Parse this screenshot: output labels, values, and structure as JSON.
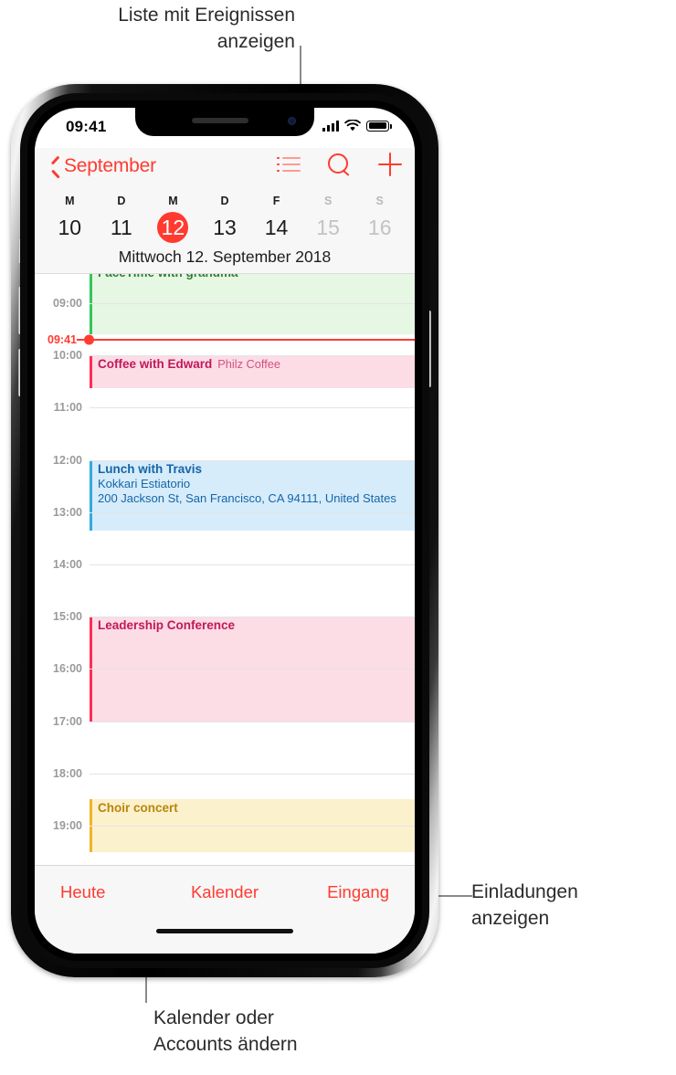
{
  "callouts": [
    {
      "id": "list-view",
      "text": "Liste mit Ereignissen\nanzeigen"
    },
    {
      "id": "inbox",
      "text": "Einladungen\nanzeigen"
    },
    {
      "id": "calendars",
      "text": "Kalender oder\nAccounts ändern"
    }
  ],
  "status_bar": {
    "time": "09:41",
    "signal_icon": "cellular-signal-icon",
    "wifi_icon": "wifi-icon",
    "battery_icon": "battery-icon"
  },
  "nav_bar": {
    "back_label": "September",
    "back_icon": "chevron-left-icon",
    "actions": [
      {
        "name": "list-view-icon",
        "label": "Liste"
      },
      {
        "name": "search-icon",
        "label": "Suchen"
      },
      {
        "name": "add-event-icon",
        "label": "Hinzufügen"
      }
    ]
  },
  "week_strip": {
    "weekday_labels": [
      "M",
      "D",
      "M",
      "D",
      "F",
      "S",
      "S"
    ],
    "days": [
      {
        "num": "10",
        "selected": false,
        "weekend": false
      },
      {
        "num": "11",
        "selected": false,
        "weekend": false
      },
      {
        "num": "12",
        "selected": true,
        "weekend": false
      },
      {
        "num": "13",
        "selected": false,
        "weekend": false
      },
      {
        "num": "14",
        "selected": false,
        "weekend": false
      },
      {
        "num": "15",
        "selected": false,
        "weekend": true
      },
      {
        "num": "16",
        "selected": false,
        "weekend": true
      }
    ],
    "day_title": "Mittwoch  12. September 2018"
  },
  "day_grid": {
    "hours": [
      "09:00",
      "10:00",
      "11:00",
      "12:00",
      "13:00",
      "14:00",
      "15:00",
      "16:00",
      "17:00",
      "18:00",
      "19:00"
    ],
    "now": {
      "label": "09:41",
      "color": "#ff3b30"
    },
    "events": [
      {
        "title": "FaceTime with grandma",
        "location": "",
        "address": "",
        "color": "#34c759",
        "fill": "#e6f7e3",
        "text": "#2e7d32",
        "start": 8.25,
        "end": 9.6
      },
      {
        "title": "Coffee with Edward",
        "location": "Philz Coffee",
        "address": "",
        "color": "#ff2d55",
        "fill": "#fcdde5",
        "text": "#c2185b",
        "start": 10.0,
        "end": 10.63
      },
      {
        "title": "Lunch with Travis",
        "location": "Kokkari Estiatorio",
        "address": "200 Jackson St, San Francisco, CA  94111, United States",
        "color": "#34aadc",
        "fill": "#d6ecfa",
        "text": "#1565a8",
        "start": 12.0,
        "end": 13.35
      },
      {
        "title": "Leadership Conference",
        "location": "",
        "address": "",
        "color": "#ff2d55",
        "fill": "#fcdce5",
        "text": "#c2185b",
        "start": 15.0,
        "end": 17.0
      },
      {
        "title": "Choir concert",
        "location": "",
        "address": "",
        "color": "#f0b429",
        "fill": "#fcf1cd",
        "text": "#b8860b",
        "start": 18.5,
        "end": 19.5
      }
    ]
  },
  "toolbar": {
    "today_label": "Heute",
    "calendars_label": "Kalender",
    "inbox_label": "Eingang"
  },
  "theme": {
    "accent": "#ff3b30",
    "chrome_bg": "#f7f7f7",
    "grid_line": "#e4e4e6",
    "hour_label": "#9a9a9e"
  }
}
